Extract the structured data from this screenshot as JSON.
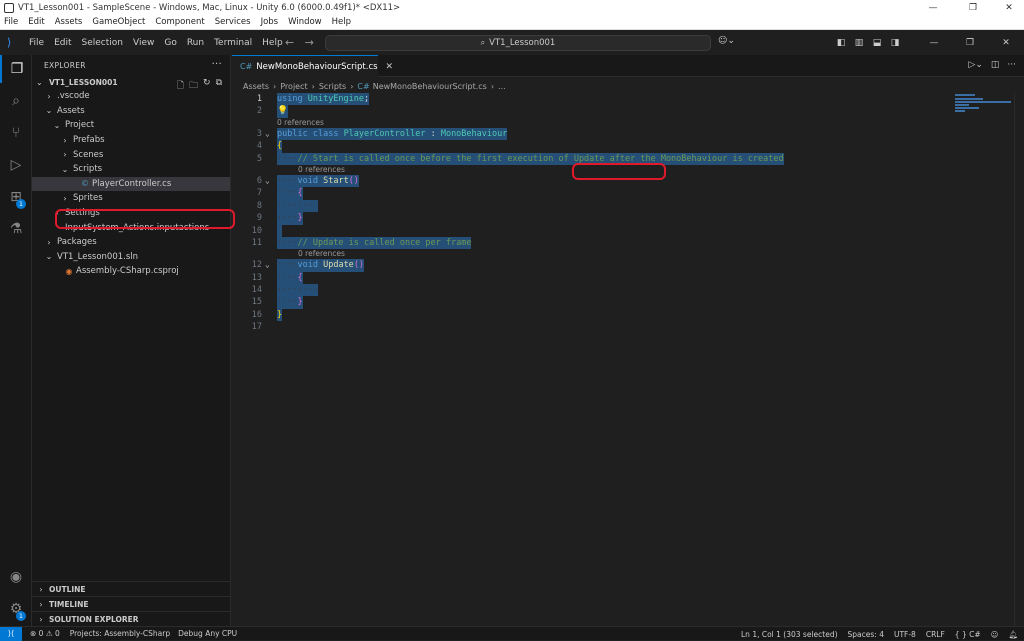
{
  "unity": {
    "title": "VT1_Lesson001 - SampleScene - Windows, Mac, Linux - Unity 6.0 (6000.0.49f1)* <DX11>",
    "menu": [
      "File",
      "Edit",
      "Assets",
      "GameObject",
      "Component",
      "Services",
      "Jobs",
      "Window",
      "Help"
    ],
    "window_controls": [
      "—",
      "❐",
      "✕"
    ]
  },
  "vscode": {
    "menu": [
      "File",
      "Edit",
      "Selection",
      "View",
      "Go",
      "Run",
      "Terminal",
      "Help"
    ],
    "command_center": "VT1_Lesson001",
    "window_controls": [
      "—",
      "❐",
      "✕"
    ]
  },
  "explorer": {
    "header": "EXPLORER",
    "workspace": "VT1_LESSON001",
    "tree": [
      {
        "label": ".vscode",
        "chev": "›",
        "icon": "",
        "indent": 1
      },
      {
        "label": "Assets",
        "chev": "⌄",
        "icon": "",
        "indent": 1
      },
      {
        "label": "Project",
        "chev": "⌄",
        "icon": "",
        "indent": 2
      },
      {
        "label": "Prefabs",
        "chev": "›",
        "icon": "",
        "indent": 3
      },
      {
        "label": "Scenes",
        "chev": "›",
        "icon": "",
        "indent": 3
      },
      {
        "label": "Scripts",
        "chev": "⌄",
        "icon": "",
        "indent": 3
      },
      {
        "label": "PlayerController.cs",
        "chev": "",
        "icon": "C#",
        "indent": 4,
        "selected": true
      },
      {
        "label": "Sprites",
        "chev": "›",
        "icon": "",
        "indent": 3
      },
      {
        "label": "Settings",
        "chev": "›",
        "icon": "",
        "indent": 2
      },
      {
        "label": "InputSystem_Actions.inputactions",
        "chev": "",
        "icon": "",
        "indent": 2
      },
      {
        "label": "Packages",
        "chev": "›",
        "icon": "",
        "indent": 1
      },
      {
        "label": "VT1_Lesson001.sln",
        "chev": "⌄",
        "icon": "",
        "indent": 1
      },
      {
        "label": "Assembly-CSharp.csproj",
        "chev": "",
        "icon": "rss",
        "indent": 2
      }
    ],
    "bottom_sections": [
      "OUTLINE",
      "TIMELINE",
      "SOLUTION EXPLORER"
    ]
  },
  "editor": {
    "tab_label": "NewMonoBehaviourScript.cs",
    "breadcrumbs": [
      "Assets",
      "Project",
      "Scripts",
      "NewMonoBehaviourScript.cs",
      "..."
    ],
    "codelens": "0 references",
    "line_numbers": [
      "1",
      "2",
      "3",
      "4",
      "5",
      "6",
      "7",
      "8",
      "9",
      "10",
      "11",
      "12",
      "13",
      "14",
      "15",
      "16",
      "17"
    ],
    "code": {
      "l1_kw": "using",
      "l1_ns": "UnityEngine",
      "l1_end": ";",
      "l3_kw1": "public",
      "l3_kw2": "class",
      "l3_name": "PlayerController",
      "l3_colon": ":",
      "l3_base": "MonoBehaviour",
      "l4": "{",
      "l5": "// Start is called once before the first execution of Update after the MonoBehaviour is created",
      "l6_kw": "void",
      "l6_fn": "Start",
      "l6_paren": "()",
      "l7": "{",
      "l9": "}",
      "l11": "// Update is called once per frame",
      "l12_kw": "void",
      "l12_fn": "Update",
      "l12_paren": "()",
      "l13": "{",
      "l15": "}",
      "l16": "}"
    }
  },
  "status": {
    "errors": "0",
    "warnings": "0",
    "projects": "Projects: Assembly-CSharp",
    "debug": "Debug Any CPU",
    "position": "Ln 1, Col 1 (303 selected)",
    "spaces": "Spaces: 4",
    "encoding": "UTF-8",
    "eol": "CRLF",
    "language": "{ } C#"
  },
  "colors": {
    "accent": "#0078d4",
    "highlight_box": "#e0192b",
    "selection": "#264f78"
  }
}
